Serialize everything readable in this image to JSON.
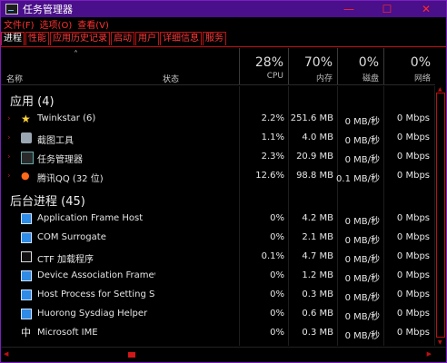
{
  "window": {
    "title": "任务管理器"
  },
  "controls": {
    "minimize": "—",
    "maximize": "☐",
    "close": "✕"
  },
  "menu": [
    "文件(F)",
    "选项(O)",
    "查看(V)"
  ],
  "tabs": [
    "进程",
    "性能",
    "应用历史记录",
    "启动",
    "用户",
    "详细信息",
    "服务"
  ],
  "active_tab": "进程",
  "columns": {
    "name": "名称",
    "status": "状态",
    "cpu": {
      "pct": "28%",
      "label": "CPU"
    },
    "mem": {
      "pct": "70%",
      "label": "内存"
    },
    "disk": {
      "pct": "0%",
      "label": "磁盘"
    },
    "net": {
      "pct": "0%",
      "label": "网络"
    }
  },
  "groups": {
    "apps": "应用 (4)",
    "background": "后台进程 (45)"
  },
  "apps": [
    {
      "name": "Twinkstar (6)",
      "icon": "star-icon",
      "cpu": "2.2%",
      "mem": "251.6 MB",
      "disk": "0 MB/秒",
      "net": "0 Mbps"
    },
    {
      "name": "截图工具",
      "icon": "snipping-tool-icon",
      "cpu": "1.1%",
      "mem": "4.0 MB",
      "disk": "0 MB/秒",
      "net": "0 Mbps"
    },
    {
      "name": "任务管理器",
      "icon": "task-manager-icon",
      "cpu": "2.3%",
      "mem": "20.9 MB",
      "disk": "0 MB/秒",
      "net": "0 Mbps"
    },
    {
      "name": "腾讯QQ (32 位)",
      "icon": "qq-icon",
      "cpu": "12.6%",
      "mem": "98.8 MB",
      "disk": "0.1 MB/秒",
      "net": "0 Mbps"
    }
  ],
  "background": [
    {
      "name": "Application Frame Host",
      "icon": "app-frame-icon",
      "cpu": "0%",
      "mem": "4.2 MB",
      "disk": "0 MB/秒",
      "net": "0 Mbps"
    },
    {
      "name": "COM Surrogate",
      "icon": "com-icon",
      "cpu": "0%",
      "mem": "2.1 MB",
      "disk": "0 MB/秒",
      "net": "0 Mbps"
    },
    {
      "name": "CTF 加载程序",
      "icon": "ctf-icon",
      "cpu": "0.1%",
      "mem": "4.7 MB",
      "disk": "0 MB/秒",
      "net": "0 Mbps"
    },
    {
      "name": "Device Association Framewor...",
      "icon": "device-icon",
      "cpu": "0%",
      "mem": "1.2 MB",
      "disk": "0 MB/秒",
      "net": "0 Mbps"
    },
    {
      "name": "Host Process for Setting Sync...",
      "icon": "host-process-icon",
      "cpu": "0%",
      "mem": "0.3 MB",
      "disk": "0 MB/秒",
      "net": "0 Mbps"
    },
    {
      "name": "Huorong Sysdiag Helper",
      "icon": "huorong-icon",
      "cpu": "0%",
      "mem": "0.6 MB",
      "disk": "0 MB/秒",
      "net": "0 Mbps"
    },
    {
      "name": "Microsoft IME",
      "icon": "ime-icon",
      "ime_glyph": "中",
      "cpu": "0%",
      "mem": "0.3 MB",
      "disk": "0 MB/秒",
      "net": "0 Mbps"
    }
  ],
  "colors": {
    "accent": "#4a0f8a",
    "highlight": "#ff2a2a"
  }
}
